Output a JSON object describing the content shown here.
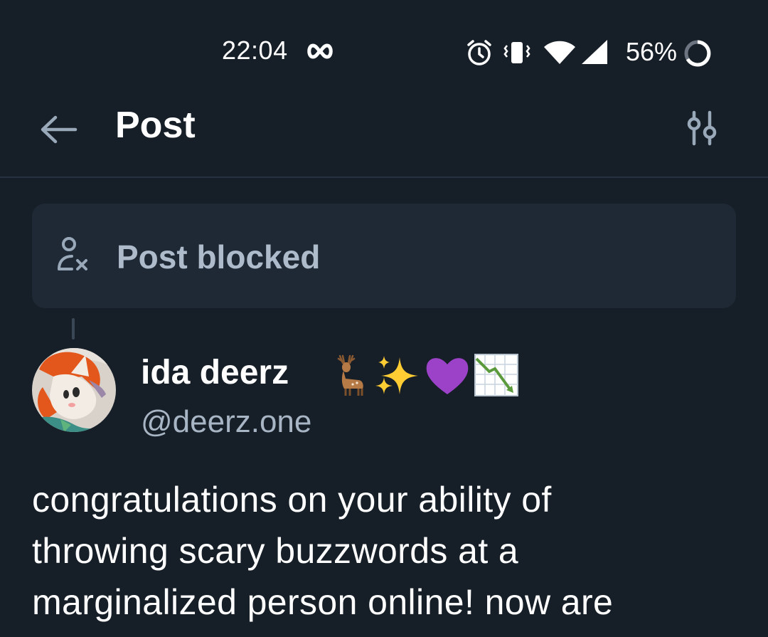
{
  "status_bar": {
    "time": "22:04",
    "battery": "56%",
    "icons": [
      "infinity-icon",
      "alarm-icon",
      "vibrate-icon",
      "wifi-icon",
      "signal-icon",
      "battery-ring-icon"
    ]
  },
  "header": {
    "title": "Post",
    "back_icon": "arrow-left-icon",
    "filter_icon": "sliders-icon"
  },
  "blocked_notice": {
    "label": "Post blocked",
    "icon": "user-blocked-icon"
  },
  "post": {
    "author": {
      "display_name": "ida deerz",
      "emojis": [
        "deer-emoji",
        "sparkles-emoji",
        "purple-heart-emoji",
        "chart-decreasing-emoji"
      ],
      "handle": "@deerz.one"
    },
    "text_lines": [
      "congratulations on your ability of",
      "throwing scary buzzwords at a",
      "marginalized person online! now are"
    ]
  },
  "colors": {
    "background": "#161e27",
    "card": "#1e2935",
    "muted_text": "#aebbcb",
    "handle_text": "#a8b5c4",
    "accent_icon": "#9aa9ba"
  }
}
